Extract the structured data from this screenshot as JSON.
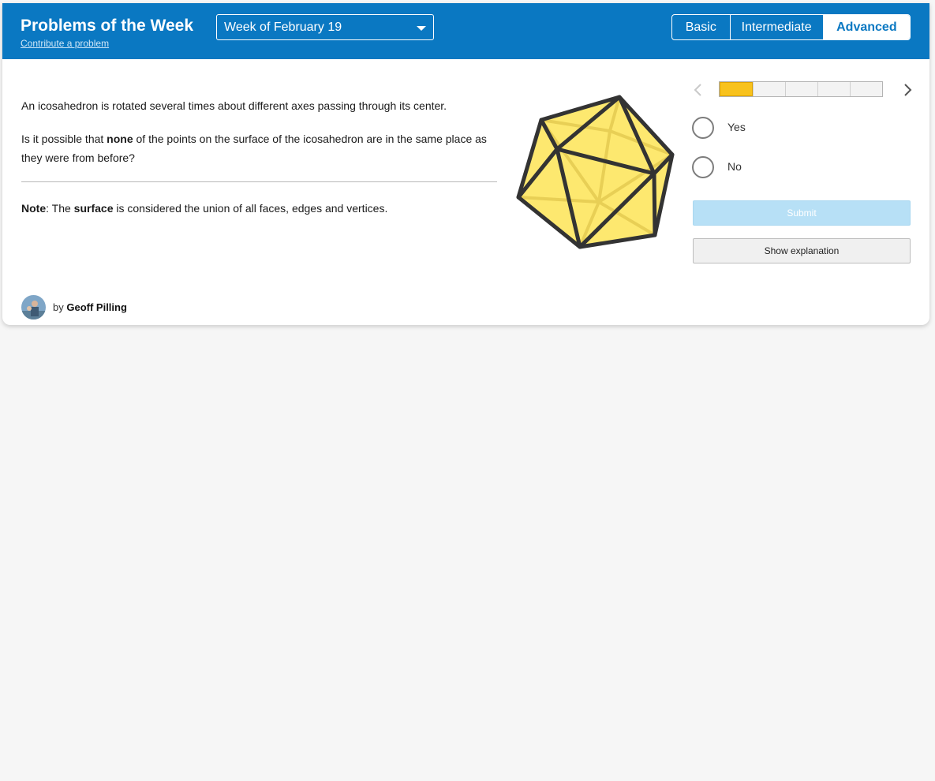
{
  "header": {
    "title": "Problems of the Week",
    "contribute_link": "Contribute a problem",
    "week_select": "Week of February 19",
    "levels": [
      "Basic",
      "Intermediate",
      "Advanced"
    ],
    "active_level": "Advanced"
  },
  "problem": {
    "line1": "An icosahedron is rotated several times about different axes passing through its center.",
    "q_prefix": "Is it possible that ",
    "q_bold": "none",
    "q_suffix": " of the points on the surface of the icosahedron are in the same place as they were from before?",
    "note_label": "Note",
    "note_mid1": ": The ",
    "note_bold": "surface",
    "note_suffix": " is considered the union of all faces, edges and vertices."
  },
  "progress": {
    "current": 1,
    "total": 5
  },
  "choices": [
    "Yes",
    "No"
  ],
  "buttons": {
    "submit": "Submit",
    "explain": "Show explanation"
  },
  "author": {
    "by": "by",
    "name": "Geoff Pilling"
  },
  "colors": {
    "header": "#0a78c2",
    "progress_fill": "#f8c21c",
    "figure_fill": "#fde86f",
    "submit_bg": "#b7e0f6"
  }
}
